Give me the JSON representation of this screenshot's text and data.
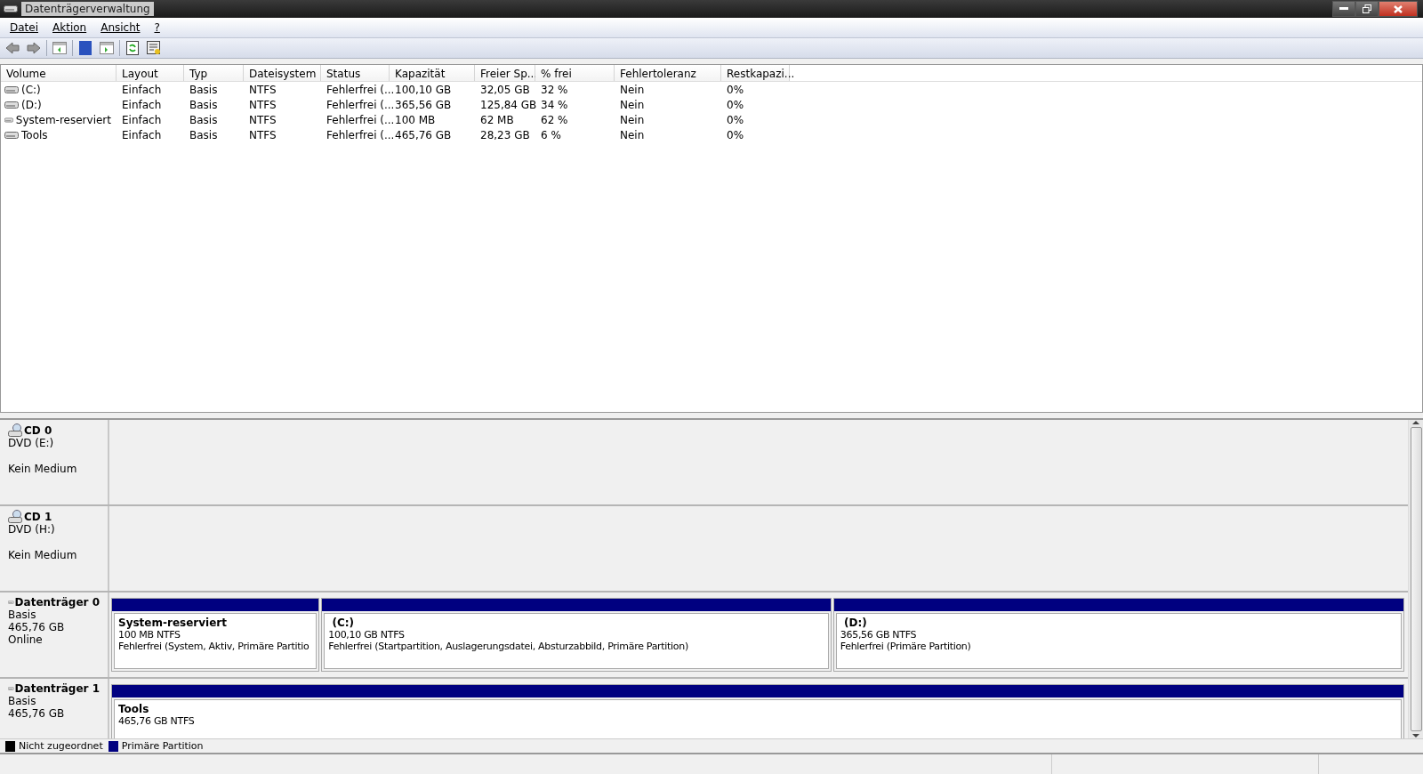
{
  "window": {
    "title": "Datenträgerverwaltung"
  },
  "menu": [
    "Datei",
    "Aktion",
    "Ansicht",
    "?"
  ],
  "table": {
    "columns": [
      "Volume",
      "Layout",
      "Typ",
      "Dateisystem",
      "Status",
      "Kapazität",
      "Freier Sp...",
      "% frei",
      "Fehlertoleranz",
      "Restkapazi..."
    ],
    "rows": [
      [
        "(C:)",
        "Einfach",
        "Basis",
        "NTFS",
        "Fehlerfrei (...",
        "100,10 GB",
        "32,05 GB",
        "32 %",
        "Nein",
        "0%"
      ],
      [
        "(D:)",
        "Einfach",
        "Basis",
        "NTFS",
        "Fehlerfrei (...",
        "365,56 GB",
        "125,84 GB",
        "34 %",
        "Nein",
        "0%"
      ],
      [
        "System-reserviert",
        "Einfach",
        "Basis",
        "NTFS",
        "Fehlerfrei (...",
        "100 MB",
        "62 MB",
        "62 %",
        "Nein",
        "0%"
      ],
      [
        "Tools",
        "Einfach",
        "Basis",
        "NTFS",
        "Fehlerfrei (...",
        "465,76 GB",
        "28,23 GB",
        "6 %",
        "Nein",
        "0%"
      ]
    ]
  },
  "disks": [
    {
      "kind": "cd",
      "name": "CD 0",
      "lines": [
        "DVD (E:)",
        "Kein Medium"
      ]
    },
    {
      "kind": "cd",
      "name": "CD 1",
      "lines": [
        "DVD (H:)",
        "Kein Medium"
      ]
    },
    {
      "kind": "disk",
      "name": "Datenträger 0",
      "lines": [
        "Basis",
        "465,76 GB",
        "Online"
      ],
      "partitions": [
        {
          "name": "System-reserviert",
          "size": "100 MB NTFS",
          "status": "Fehlerfrei (System, Aktiv, Primäre Partitio",
          "color": "#000080"
        },
        {
          "name": " (C:)",
          "size": "100,10 GB NTFS",
          "status": "Fehlerfrei (Startpartition, Auslagerungsdatei, Absturzabbild, Primäre Partition)",
          "color": "#000080"
        },
        {
          "name": " (D:)",
          "size": "365,56 GB NTFS",
          "status": "Fehlerfrei (Primäre Partition)",
          "color": "#000080"
        }
      ]
    },
    {
      "kind": "disk",
      "name": "Datenträger 1",
      "lines": [
        "Basis",
        "465,76 GB"
      ],
      "partitions": [
        {
          "name": "Tools",
          "size": "465,76 GB NTFS",
          "color": "#000080"
        }
      ]
    }
  ],
  "legend": [
    {
      "label": "Nicht zugeordnet",
      "color": "#000000"
    },
    {
      "label": "Primäre Partition",
      "color": "#000080"
    }
  ]
}
